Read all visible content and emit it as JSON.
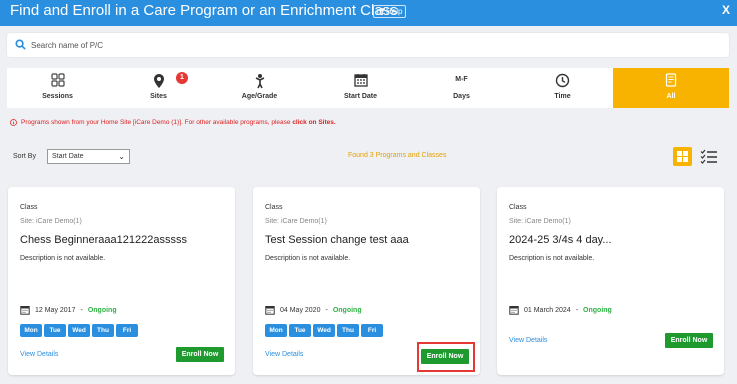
{
  "header": {
    "title": "Find and Enroll in a Care Program or an Enrichment Class",
    "help_label": "Help",
    "close_label": "X"
  },
  "search": {
    "placeholder": "Search name of P/C",
    "value": ""
  },
  "filters": [
    {
      "label": "Sessions",
      "icon": "grid-icon"
    },
    {
      "label": "Sites",
      "icon": "map-pin-icon",
      "badge": "1"
    },
    {
      "label": "Age/Grade",
      "icon": "child-icon"
    },
    {
      "label": "Start Date",
      "icon": "calendar-icon"
    },
    {
      "label": "Days",
      "icon_text": "M-F"
    },
    {
      "label": "Time",
      "icon": "clock-icon"
    },
    {
      "label": "All",
      "icon": "document-icon",
      "active": true
    }
  ],
  "notice": {
    "text": "Programs shown from your Home Site [iCare Demo (1)]. For other available programs, please ",
    "link": "click on Sites."
  },
  "sort": {
    "label": "Sort By",
    "value": "Start Date"
  },
  "found_text": "Found 3 Programs and Classes",
  "colors": {
    "header": "#2b8fe0",
    "active_filter": "#f7b300",
    "enroll": "#1e9a2f",
    "ongoing": "#2fb344",
    "notice": "#dd2222",
    "highlight": "#e53935"
  },
  "cards": [
    {
      "type": "Class",
      "site": "Site: iCare Demo(1)",
      "name": "Chess Beginneraaa121222asssss",
      "description": "Description is not available.",
      "date": "12 May 2017",
      "status": "Ongoing",
      "days": [
        "Mon",
        "Tue",
        "Wed",
        "Thu",
        "Fri"
      ],
      "view_details": "View Details",
      "enroll": "Enroll Now"
    },
    {
      "type": "Class",
      "site": "Site: iCare Demo(1)",
      "name": "Test Session change test aaa",
      "description": "Description is not available.",
      "date": "04 May 2020",
      "status": "Ongoing",
      "days": [
        "Mon",
        "Tue",
        "Wed",
        "Thu",
        "Fri"
      ],
      "view_details": "View Details",
      "enroll": "Enroll Now"
    },
    {
      "type": "Class",
      "site": "Site: iCare Demo(1)",
      "name": "2024-25 3/4s 4 day...",
      "description": "Description is not available.",
      "date": "01 March 2024",
      "status": "Ongoing",
      "days": [],
      "view_details": "View Details",
      "enroll": "Enroll Now"
    }
  ]
}
